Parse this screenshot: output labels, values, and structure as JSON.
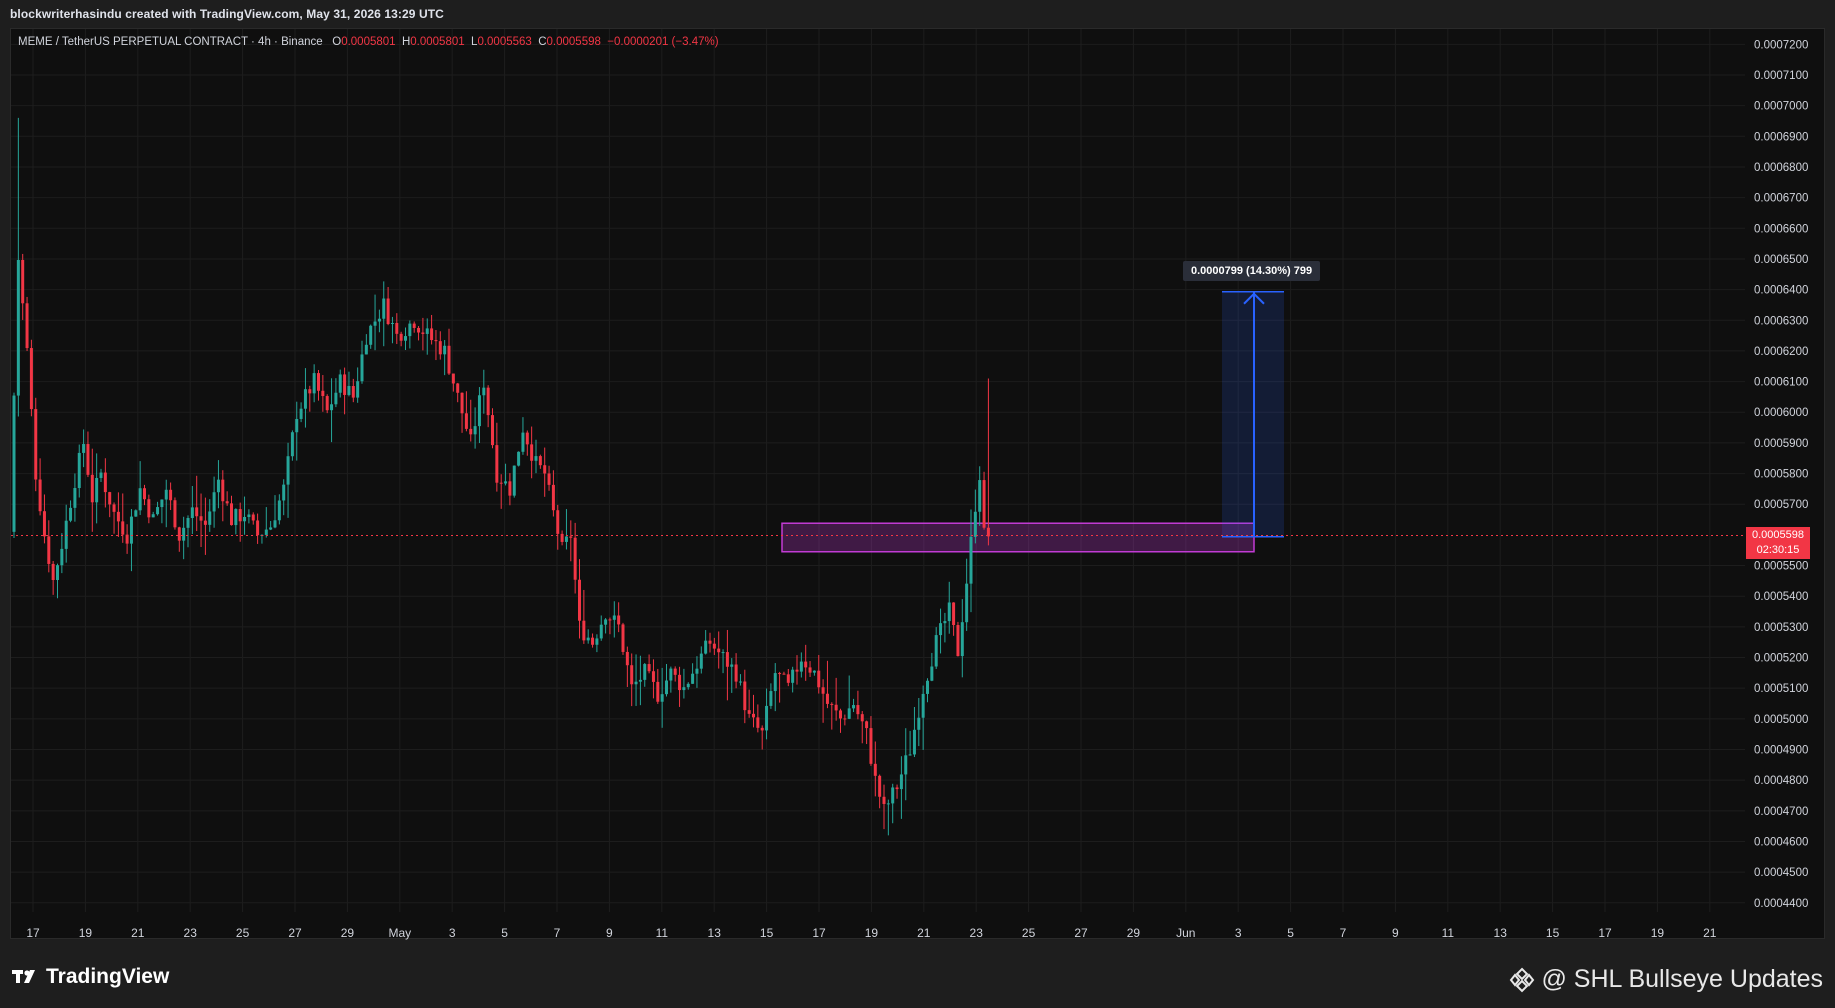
{
  "caption": "blockwriterhasindu created with TradingView.com, May 31, 2026 13:29 UTC",
  "legend": {
    "symbol": "MEME / TetherUS PERPETUAL CONTRACT · 4h · Binance",
    "o_label": "O",
    "o_value": "0.0005801",
    "h_label": "H",
    "h_value": "0.0005801",
    "l_label": "L",
    "l_value": "0.0005563",
    "c_label": "C",
    "c_value": "0.0005598",
    "change": "−0.0000201 (−3.47%)"
  },
  "current_price": {
    "value": "0.0005598",
    "countdown": "02:30:15"
  },
  "measure": {
    "label": "0.0000799 (14.30%) 799"
  },
  "footer": {
    "brand": "TradingView",
    "watermark": "@ SHL Bullseye Updates"
  },
  "colors": {
    "up": "#26a69a",
    "down": "#f23645",
    "zone": "#c23bd4",
    "measure": "#2962ff",
    "background": "#0f0f0f",
    "grid": "#1d1d1d"
  },
  "chart_data": {
    "type": "candlestick",
    "interval": "4h",
    "ylim": [
      0.000437,
      0.000725
    ],
    "y_ticks": [
      "0.0007200",
      "0.0007100",
      "0.0007000",
      "0.0006900",
      "0.0006800",
      "0.0006700",
      "0.0006600",
      "0.0006500",
      "0.0006400",
      "0.0006300",
      "0.0006200",
      "0.0006100",
      "0.0006000",
      "0.0005900",
      "0.0005800",
      "0.0005700",
      "0.0005500",
      "0.0005400",
      "0.0005300",
      "0.0005200",
      "0.0005100",
      "0.0005000",
      "0.0004900",
      "0.0004800",
      "0.0004700",
      "0.0004600",
      "0.0004500",
      "0.0004400"
    ],
    "x_ticks": [
      "17",
      "19",
      "21",
      "23",
      "25",
      "27",
      "29",
      "May",
      "3",
      "5",
      "7",
      "9",
      "11",
      "13",
      "15",
      "17",
      "19",
      "21",
      "23",
      "25",
      "27",
      "29",
      "Jun",
      "3",
      "5",
      "7",
      "9",
      "11",
      "13",
      "15",
      "17",
      "19",
      "21"
    ],
    "price_path": [
      [
        0,
        0.000561
      ],
      [
        2,
        0.00065
      ],
      [
        4,
        0.00062
      ],
      [
        6,
        0.00058
      ],
      [
        8,
        0.00056
      ],
      [
        10,
        0.000545
      ],
      [
        12,
        0.000557
      ],
      [
        15,
        0.000578
      ],
      [
        17,
        0.00059
      ],
      [
        19,
        0.000572
      ],
      [
        21,
        0.00058
      ],
      [
        24,
        0.000567
      ],
      [
        27,
        0.00056
      ],
      [
        30,
        0.000575
      ],
      [
        33,
        0.000565
      ],
      [
        36,
        0.000575
      ],
      [
        39,
        0.00056
      ],
      [
        42,
        0.000568
      ],
      [
        45,
        0.000563
      ],
      [
        48,
        0.000578
      ],
      [
        51,
        0.000565
      ],
      [
        54,
        0.000567
      ],
      [
        57,
        0.00056
      ],
      [
        60,
        0.000563
      ],
      [
        63,
        0.000575
      ],
      [
        66,
        0.0006
      ],
      [
        70,
        0.00061
      ],
      [
        73,
        0.0006
      ],
      [
        76,
        0.00061
      ],
      [
        79,
        0.000605
      ],
      [
        82,
        0.000625
      ],
      [
        86,
        0.000635
      ],
      [
        89,
        0.000625
      ],
      [
        93,
        0.00063
      ],
      [
        96,
        0.000625
      ],
      [
        100,
        0.00062
      ],
      [
        103,
        0.000605
      ],
      [
        106,
        0.00059
      ],
      [
        109,
        0.00061
      ],
      [
        112,
        0.00058
      ],
      [
        115,
        0.000575
      ],
      [
        118,
        0.000595
      ],
      [
        121,
        0.000583
      ],
      [
        123,
        0.00058
      ],
      [
        125,
        0.000567
      ],
      [
        127,
        0.000555
      ],
      [
        129,
        0.00056
      ],
      [
        131,
        0.00053
      ],
      [
        134,
        0.000525
      ],
      [
        137,
        0.000535
      ],
      [
        140,
        0.00053
      ],
      [
        143,
        0.00051
      ],
      [
        146,
        0.000515
      ],
      [
        149,
        0.000508
      ],
      [
        152,
        0.000515
      ],
      [
        155,
        0.00051
      ],
      [
        158,
        0.000518
      ],
      [
        161,
        0.000525
      ],
      [
        164,
        0.00052
      ],
      [
        167,
        0.000515
      ],
      [
        170,
        0.0005
      ],
      [
        173,
        0.000495
      ],
      [
        176,
        0.000515
      ],
      [
        179,
        0.00051
      ],
      [
        182,
        0.00052
      ],
      [
        185,
        0.000515
      ],
      [
        188,
        0.000505
      ],
      [
        191,
        0.0005
      ],
      [
        194,
        0.000505
      ],
      [
        197,
        0.000495
      ],
      [
        199,
        0.00048
      ],
      [
        201,
        0.00047
      ],
      [
        204,
        0.000478
      ],
      [
        207,
        0.00049
      ],
      [
        210,
        0.00051
      ],
      [
        213,
        0.000525
      ],
      [
        216,
        0.000535
      ],
      [
        218,
        0.000522
      ],
      [
        220,
        0.000545
      ],
      [
        222,
        0.00057
      ],
      [
        223,
        0.00058
      ],
      [
        224,
        0.00056
      ]
    ]
  }
}
